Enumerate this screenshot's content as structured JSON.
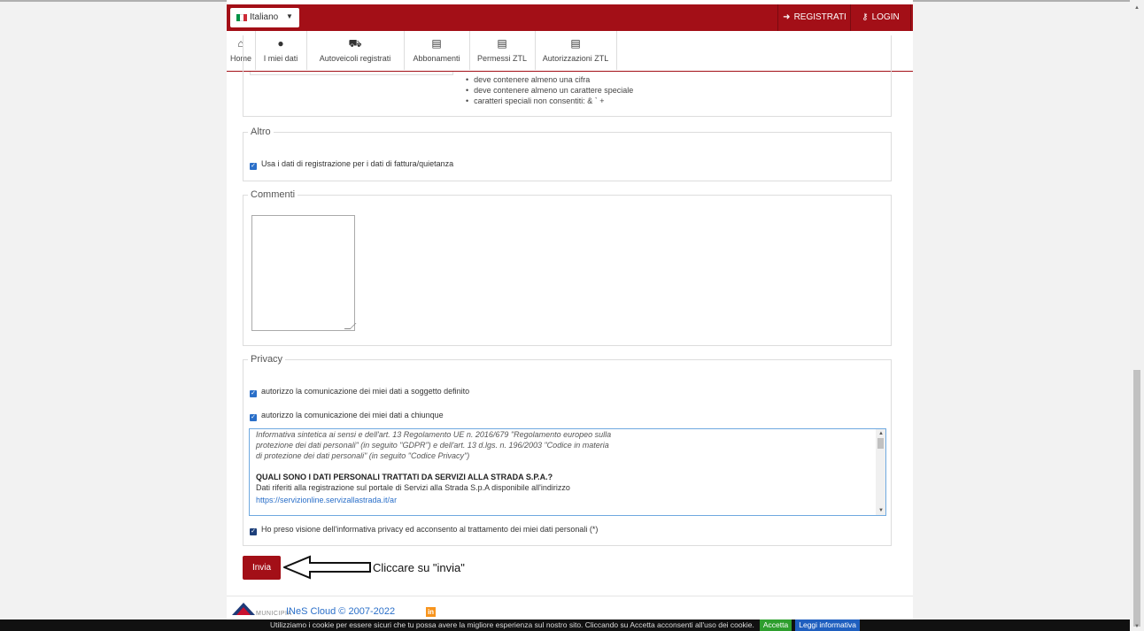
{
  "header": {
    "language": "Italiano",
    "register_label": "REGISTRATI",
    "login_label": "LOGIN",
    "brand_color": "#a30f17"
  },
  "nav": {
    "items": [
      {
        "label": "Home",
        "icon": "home-icon"
      },
      {
        "label": "I miei dati",
        "icon": "user-icon"
      },
      {
        "label": "Autoveicoli registrati",
        "icon": "car-icon"
      },
      {
        "label": "Abbonamenti",
        "icon": "document-icon"
      },
      {
        "label": "Permessi ZTL",
        "icon": "document-icon"
      },
      {
        "label": "Autorizzazioni ZTL",
        "icon": "document-icon"
      }
    ]
  },
  "password_rules": [
    "deve contenere almeno una cifra",
    "deve contenere almeno un carattere speciale",
    "caratteri speciali non consentiti: & ` +"
  ],
  "altro": {
    "legend": "Altro",
    "checkbox_label": "Usa i dati di registrazione per i dati di fattura/quietanza",
    "checked": true
  },
  "commenti": {
    "legend": "Commenti",
    "value": ""
  },
  "privacy": {
    "legend": "Privacy",
    "consent_defined": "autorizzo la comunicazione dei miei dati a soggetto definito",
    "consent_anyone": "autorizzo la comunicazione dei miei dati a chiunque",
    "info_lines": [
      "Informativa sintetica ai sensi e dell'art. 13 Regolamento UE n. 2016/679 \"Regolamento europeo sulla",
      "protezione dei dati personali\" (in seguito \"GDPR\") e dell'art. 13 d.lgs. n. 196/2003 \"Codice in materia",
      "di protezione dei dati personali\" (in seguito \"Codice Privacy\")"
    ],
    "info_heading": "QUALI SONO I DATI PERSONALI TRATTATI DA SERVIZI ALLA STRADA S.P.A.?",
    "info_text": "Dati riferiti alla registrazione sul portale di Servizi alla Strada S.p.A disponibile all'indirizzo",
    "info_link": "https://servizionline.servizallastrada.it/ar",
    "acknowledge": "Ho preso visione dell'informativa privacy ed acconsento al trattamento dei miei dati personali (*)"
  },
  "actions": {
    "submit_label": "Invia",
    "annotation": "Cliccare su \"invia\""
  },
  "footer": {
    "logo_text": "MUNICIPIA",
    "copyright": "INeS Cloud © 2007-2022",
    "linkedin": "in"
  },
  "cookie_bar": {
    "message": "Utilizziamo i cookie per essere sicuri che tu possa avere la migliore esperienza sul nostro sito. Cliccando su Accetta acconsenti all'uso dei cookie.",
    "accept_label": "Accetta",
    "info_label": "Leggi informativa"
  }
}
